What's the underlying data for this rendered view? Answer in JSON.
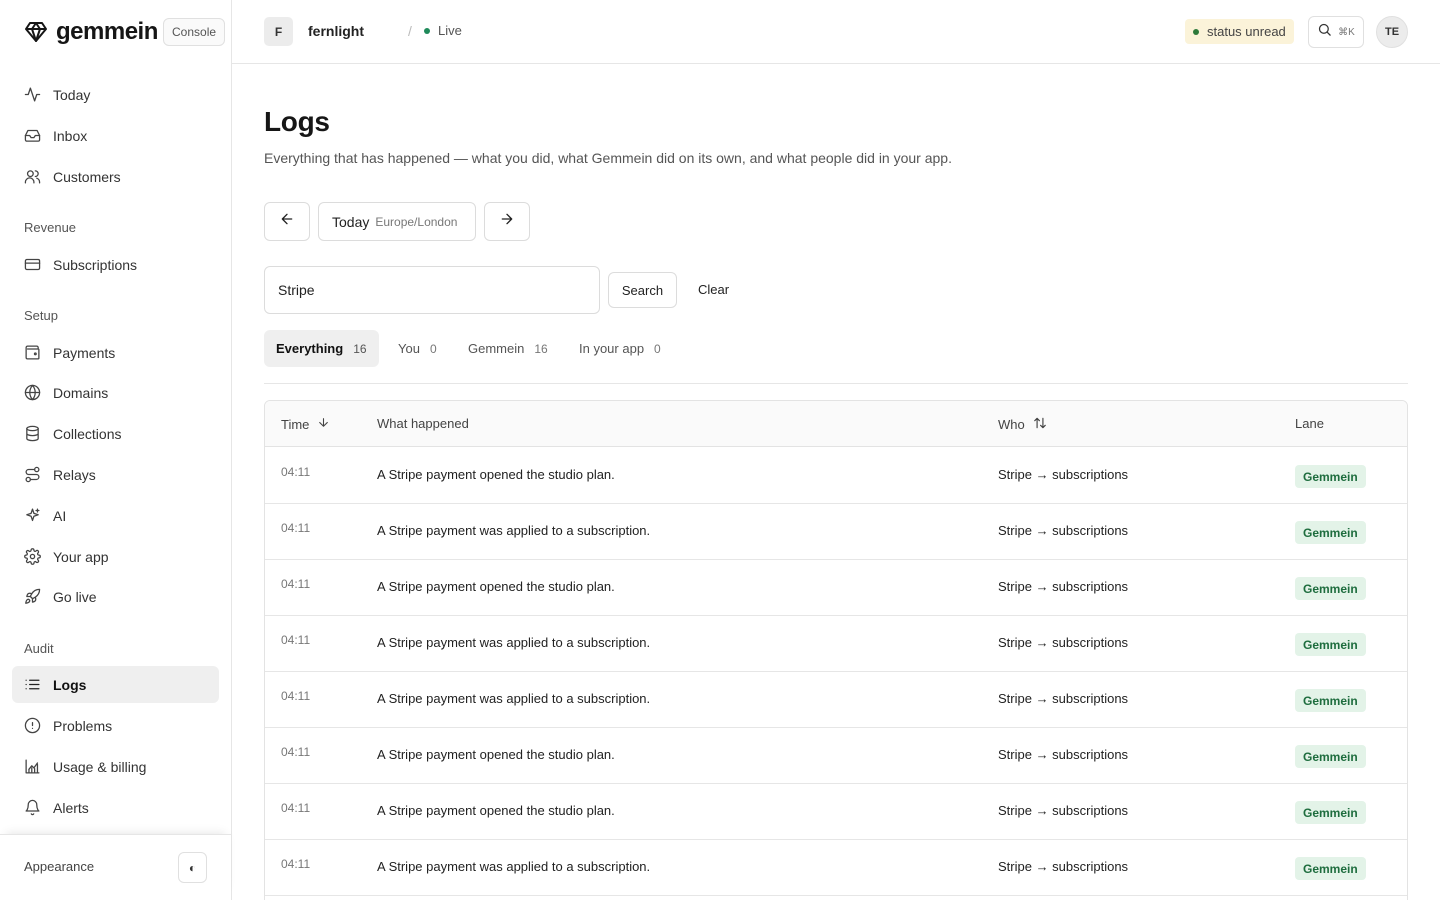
{
  "brand": {
    "name": "gemmein",
    "console_label": "Console"
  },
  "sidebar": {
    "top_items": [
      {
        "label": "Today",
        "icon": "activity-icon"
      },
      {
        "label": "Inbox",
        "icon": "inbox-icon"
      },
      {
        "label": "Customers",
        "icon": "users-icon"
      }
    ],
    "sections": [
      {
        "title": "Revenue",
        "items": [
          {
            "label": "Subscriptions",
            "icon": "credit-card-icon"
          }
        ]
      },
      {
        "title": "Setup",
        "items": [
          {
            "label": "Payments",
            "icon": "wallet-icon"
          },
          {
            "label": "Domains",
            "icon": "globe-icon"
          },
          {
            "label": "Collections",
            "icon": "database-icon"
          },
          {
            "label": "Relays",
            "icon": "route-icon"
          },
          {
            "label": "AI",
            "icon": "sparkles-icon"
          },
          {
            "label": "Your app",
            "icon": "gear-icon"
          },
          {
            "label": "Go live",
            "icon": "rocket-icon"
          }
        ]
      },
      {
        "title": "Audit",
        "items": [
          {
            "label": "Logs",
            "icon": "list-icon",
            "active": true
          },
          {
            "label": "Problems",
            "icon": "alert-circle-icon"
          },
          {
            "label": "Usage & billing",
            "icon": "chart-icon"
          },
          {
            "label": "Alerts",
            "icon": "bell-icon"
          }
        ]
      }
    ],
    "appearance_label": "Appearance",
    "appearance_toggle": "◐"
  },
  "topbar": {
    "project_initial": "F",
    "project_name": "fernlight",
    "separator": "/",
    "env_label": "Live",
    "status_label": "status unread",
    "search_shortcut": "⌘K",
    "avatar_initials": "TE"
  },
  "page": {
    "title": "Logs",
    "subtitle": "Everything that has happened — what you did, what Gemmein did on its own, and what people did in your app."
  },
  "date_nav": {
    "day": "Today",
    "timezone": "Europe/London"
  },
  "search": {
    "value": "Stripe",
    "submit_label": "Search",
    "clear_label": "Clear"
  },
  "tabs": [
    {
      "label": "Everything",
      "count": "16",
      "active": true
    },
    {
      "label": "You",
      "count": "0"
    },
    {
      "label": "Gemmein",
      "count": "16"
    },
    {
      "label": "In your app",
      "count": "0"
    }
  ],
  "table": {
    "headers": {
      "time": "Time",
      "what": "What happened",
      "who": "Who",
      "lane": "Lane"
    },
    "rows": [
      {
        "time": "04:11",
        "what": "A Stripe payment opened the studio plan.",
        "who": "Stripe → subscriptions",
        "lane": "Gemmein"
      },
      {
        "time": "04:11",
        "what": "A Stripe payment was applied to a subscription.",
        "who": "Stripe → subscriptions",
        "lane": "Gemmein"
      },
      {
        "time": "04:11",
        "what": "A Stripe payment opened the studio plan.",
        "who": "Stripe → subscriptions",
        "lane": "Gemmein"
      },
      {
        "time": "04:11",
        "what": "A Stripe payment was applied to a subscription.",
        "who": "Stripe → subscriptions",
        "lane": "Gemmein"
      },
      {
        "time": "04:11",
        "what": "A Stripe payment was applied to a subscription.",
        "who": "Stripe → subscriptions",
        "lane": "Gemmein"
      },
      {
        "time": "04:11",
        "what": "A Stripe payment opened the studio plan.",
        "who": "Stripe → subscriptions",
        "lane": "Gemmein"
      },
      {
        "time": "04:11",
        "what": "A Stripe payment opened the studio plan.",
        "who": "Stripe → subscriptions",
        "lane": "Gemmein"
      },
      {
        "time": "04:11",
        "what": "A Stripe payment was applied to a subscription.",
        "who": "Stripe → subscriptions",
        "lane": "Gemmein"
      }
    ]
  },
  "colors": {
    "live_dot": "#1f8a5a",
    "lane_bg": "#e3f3e8",
    "lane_text": "#1e6d3e",
    "status_bg": "#fbf3d9"
  }
}
